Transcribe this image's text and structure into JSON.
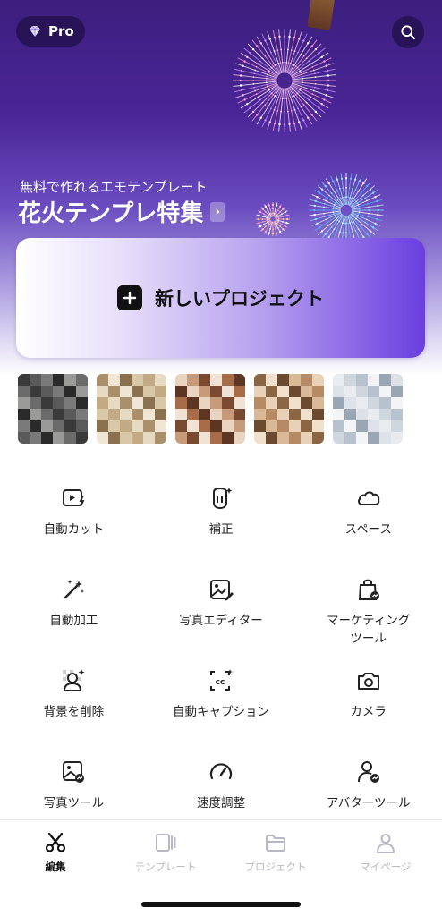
{
  "header": {
    "pro_label": "Pro",
    "pro_icon": "diamond-icon",
    "search_icon": "search-icon"
  },
  "promo": {
    "subtitle": "無料で作れるエモテンプレート",
    "title": "花火テンプレ特集",
    "arrow": "›"
  },
  "new_project": {
    "label": "新しいプロジェクト",
    "icon": "plus-icon"
  },
  "recent_projects_count_visible": 5,
  "tools": [
    {
      "label": "自動カット",
      "icon": "auto-cut-icon"
    },
    {
      "label": "補正",
      "icon": "retouch-icon"
    },
    {
      "label": "スペース",
      "icon": "cloud-icon"
    },
    {
      "label": "自動加工",
      "icon": "magic-wand-icon"
    },
    {
      "label": "写真エディター",
      "icon": "photo-edit-icon"
    },
    {
      "label": "マーケティング\nツール",
      "icon": "marketing-bag-icon"
    },
    {
      "label": "背景を削除",
      "icon": "remove-background-icon"
    },
    {
      "label": "自動キャプション",
      "icon": "caption-icon"
    },
    {
      "label": "カメラ",
      "icon": "camera-icon"
    },
    {
      "label": "写真ツール",
      "icon": "photo-tools-icon"
    },
    {
      "label": "速度調整",
      "icon": "speed-gauge-icon"
    },
    {
      "label": "アバターツール",
      "icon": "avatar-tool-icon"
    }
  ],
  "tabbar": {
    "tabs": [
      {
        "label": "編集",
        "icon": "scissors-icon",
        "active": true
      },
      {
        "label": "テンプレート",
        "icon": "template-icon",
        "active": false
      },
      {
        "label": "プロジェクト",
        "icon": "folder-icon",
        "active": false
      },
      {
        "label": "マイページ",
        "icon": "profile-icon",
        "active": false
      }
    ]
  },
  "colors": {
    "hero_top": "#3c1f7e",
    "accent": "#6a3ee0",
    "tab_active": "#111111",
    "tab_inactive": "#b8b8c4"
  }
}
